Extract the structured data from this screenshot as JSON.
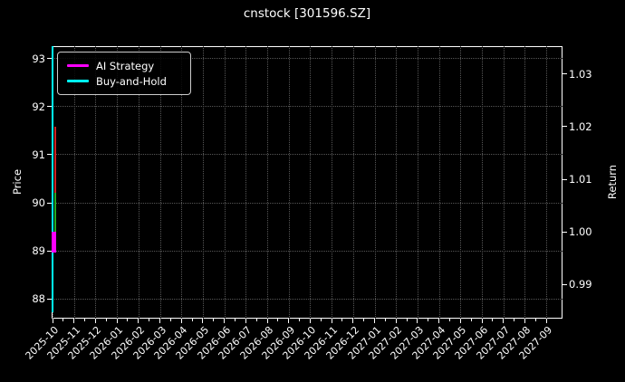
{
  "title": "cnstock [301596.SZ]",
  "colors": {
    "background": "#000000",
    "text": "#ffffff",
    "spine": "#ffffff",
    "grid": "#565656",
    "ai_strategy": "#ff00ff",
    "buy_and_hold": "#00ffff",
    "candle_down": "#cc2222",
    "candle_up": "#22aa22"
  },
  "legend": {
    "items": [
      {
        "label": "AI Strategy",
        "color": "#ff00ff"
      },
      {
        "label": "Buy-and-Hold",
        "color": "#00ffff"
      }
    ]
  },
  "axes": {
    "left": {
      "label": "Price",
      "ticks": [
        "93",
        "92",
        "91",
        "90",
        "89",
        "88"
      ],
      "range": [
        87.59,
        93.26
      ]
    },
    "right": {
      "label": "Return",
      "ticks": [
        "1.03",
        "1.02",
        "1.01",
        "1.00",
        "0.99"
      ],
      "range": [
        0.9835,
        1.0353
      ]
    },
    "x": {
      "tick_labels": [
        "2025-10",
        "2025-11",
        "2025-12",
        "2026-01",
        "2026-02",
        "2026-03",
        "2026-04",
        "2026-05",
        "2026-06",
        "2026-07",
        "2026-08",
        "2026-09",
        "2026-10",
        "2026-11",
        "2026-12",
        "2027-01",
        "2027-02",
        "2027-03",
        "2027-04",
        "2027-05",
        "2027-06",
        "2027-07",
        "2027-08",
        "2027-09"
      ],
      "rotation_deg": 45,
      "minor_ticks": true
    }
  },
  "chart_data": {
    "type": "line",
    "title": "cnstock [301596.SZ]",
    "xlabel": "",
    "ylabel_left": "Price",
    "ylabel_right": "Return",
    "x_axis_shown_range": [
      "2025-10",
      "2027-09"
    ],
    "data_x_location": "2025-10",
    "left_axis_range": [
      87.59,
      93.26
    ],
    "right_axis_range": [
      0.9835,
      1.0353
    ],
    "grid": true,
    "legend_position": "upper left",
    "series": [
      {
        "name": "AI Strategy",
        "axis": "Return",
        "color": "#ff00ff",
        "x": "2025-10",
        "value_range": [
          0.996,
          1.0
        ]
      },
      {
        "name": "Buy-and-Hold",
        "axis": "Return",
        "color": "#00ffff",
        "x": "2025-10",
        "value_range": [
          0.9847,
          1.0353
        ]
      },
      {
        "name": "Price down candles",
        "axis": "Price",
        "color": "#cc2222",
        "x": "2025-10",
        "value_range": [
          90.21,
          91.59
        ]
      },
      {
        "name": "Price up candles",
        "axis": "Price",
        "color": "#22aa22",
        "x": "2025-10",
        "value_range": [
          89.36,
          90.21
        ]
      }
    ],
    "note": "All plotted data is compressed at the far-left edge (2025-10) while the x-axis extends to 2027-09, producing vertical colored strips."
  }
}
